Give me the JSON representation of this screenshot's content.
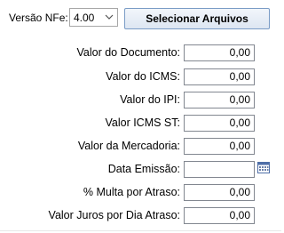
{
  "header": {
    "versao_label": "Versão NFe:",
    "versao_value": "4.00",
    "select_files_label": "Selecionar Arquivos"
  },
  "fields": [
    {
      "label": "Valor do Documento:",
      "value": "0,00"
    },
    {
      "label": "Valor do ICMS:",
      "value": "0,00"
    },
    {
      "label": "Valor do IPI:",
      "value": "0,00"
    },
    {
      "label": "Valor ICMS ST:",
      "value": "0,00"
    },
    {
      "label": "Valor da Mercadoria:",
      "value": "0,00"
    },
    {
      "label": "Data Emissão:",
      "value": ""
    },
    {
      "label": "% Multa por Atraso:",
      "value": "0,00"
    },
    {
      "label": "Valor Juros por Dia Atraso:",
      "value": "0,00"
    }
  ],
  "icons": {
    "dropdown": "chevron-down-icon",
    "calendar": "calendar-icon"
  },
  "colors": {
    "button_border": "#7a9cc6",
    "input_border": "#828790",
    "calendar_accent": "#4f6fa8"
  }
}
